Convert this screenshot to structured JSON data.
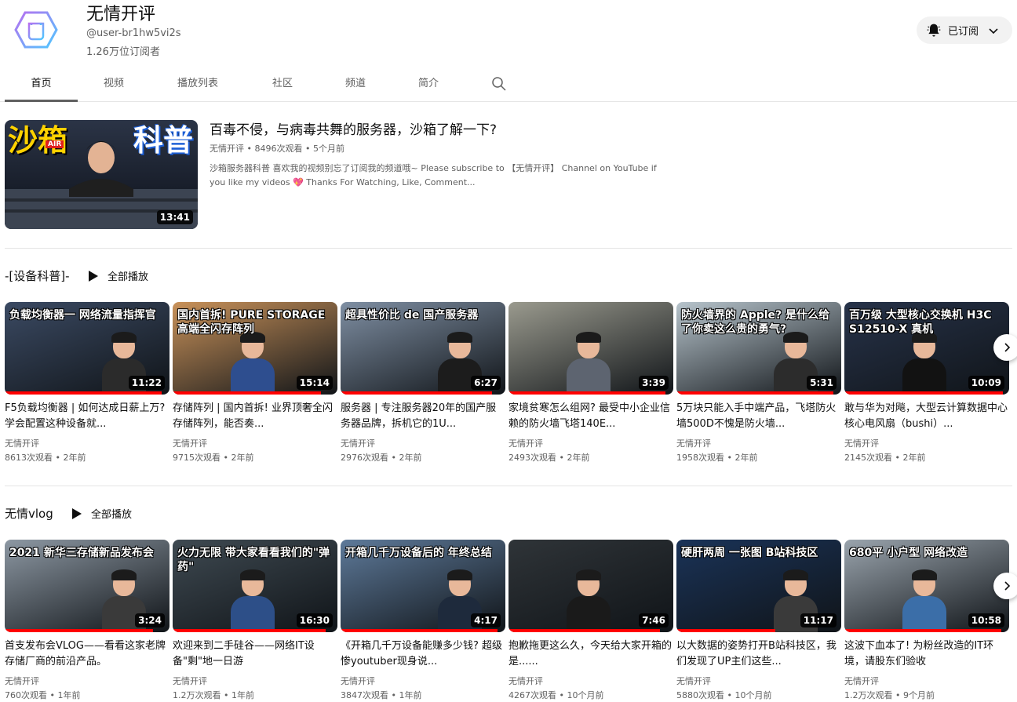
{
  "channel": {
    "name": "无情开评",
    "handle": "@user-br1hw5vi2s",
    "subscribers": "1.26万位订阅者",
    "subscribe_label": "已订阅"
  },
  "tabs": [
    {
      "label": "首页",
      "active": true
    },
    {
      "label": "视频"
    },
    {
      "label": "播放列表"
    },
    {
      "label": "社区"
    },
    {
      "label": "频道"
    },
    {
      "label": "简介"
    }
  ],
  "featured": {
    "thumb_text_left": "沙箱",
    "thumb_badge": "AIR",
    "thumb_text_right": "科普",
    "duration": "13:41",
    "title": "百毒不侵，与病毒共舞的服务器，沙箱了解一下?",
    "meta": "无情开评 • 8496次观看 • 5个月前",
    "desc_line1": "沙箱服务器科普 喜欢我的视频别忘了订阅我的频道哦~ Please subscribe to 【无情开评】 Channel on YouTube if",
    "desc_line2a": "you like my videos ",
    "desc_heart": "💖",
    "desc_line2b": " Thanks For Watching, Like, Comment..."
  },
  "shelf1": {
    "title": "-[设备科普]-",
    "play_all": "全部播放",
    "videos": [
      {
        "overlay": "负载均衡器一 网络流量指挥官",
        "duration": "11:22",
        "title": "F5负载均衡器 | 如何达成日薪上万? 学会配置这种设备就...",
        "channel": "无情开评",
        "meta": "8613次观看 • 2年前",
        "bg": "#3b4a63",
        "shirt": "#2b2b2b",
        "progress": 0.95
      },
      {
        "overlay": "国内首拆! PURE STORAGE 高端全闪存阵列",
        "duration": "15:14",
        "title": "存储阵列 | 国内首拆! 业界顶奢全闪存储阵列，能否奏...",
        "channel": "无情开评",
        "meta": "9715次观看 • 2年前",
        "bg": "#c9925a",
        "shirt": "#2e4e8f",
        "progress": 0.9
      },
      {
        "overlay": "超具性价比 de 国产服务器",
        "duration": "6:27",
        "title": "服务器 | 专注服务器20年的国产服务器品牌，拆机它的1U...",
        "channel": "无情开评",
        "meta": "2976次观看 • 2年前",
        "bg": "#7f8fa3",
        "shirt": "#1c1c1c",
        "progress": 0.92
      },
      {
        "overlay": "",
        "duration": "3:39",
        "title": "家境贫寒怎么组网? 最受中小企业信赖的防火墙飞塔140E...",
        "channel": "无情开评",
        "meta": "2493次观看 • 2年前",
        "bg": "#9a9a8e",
        "shirt": "#5d6470",
        "progress": 0.95
      },
      {
        "overlay": "防火墙界的 Apple? 是什么给了你卖这么贵的勇气?",
        "duration": "5:31",
        "title": "5万块只能入手中端产品，飞塔防火墙500D不愧是防火墙...",
        "channel": "无情开评",
        "meta": "1958次观看 • 2年前",
        "bg": "#b7c4cc",
        "shirt": "#2c2c2c",
        "progress": 0.95
      },
      {
        "overlay": "百万级 大型核心交换机 H3C S12510-X 真机",
        "duration": "10:09",
        "title": "敢与华为对飚，大型云计算数据中心核心电风扇（bushi）...",
        "channel": "无情开评",
        "meta": "2145次观看 • 2年前",
        "bg": "#27334a",
        "shirt": "#121212",
        "progress": 0.96
      }
    ]
  },
  "shelf2": {
    "title": "无情vlog",
    "play_all": "全部播放",
    "videos": [
      {
        "overlay": "2021 新华三存储新品发布会",
        "duration": "3:24",
        "title": "首支发布会VLOG——看看这家老牌存储厂商的前沿产品。",
        "channel": "无情开评",
        "meta": "760次观看 • 1年前",
        "bg": "#8d98a3",
        "shirt": "#3a3a3a",
        "progress": 0.9
      },
      {
        "overlay": "火力无限 带大家看看我们的\"弹药\"",
        "duration": "16:30",
        "title": "欢迎来到二手硅谷——网络IT设备\"剩\"地一日游",
        "channel": "无情开评",
        "meta": "1.2万次观看 • 1年前",
        "bg": "#3f4a52",
        "shirt": "#2d4f88",
        "progress": 0.93
      },
      {
        "overlay": "开箱几千万设备后的 年终总结",
        "duration": "4:17",
        "title": "《开箱几千万设备能赚多少钱? 超级惨youtuber现身说...",
        "channel": "无情开评",
        "meta": "3847次观看 • 1年前",
        "bg": "#5e7a9a",
        "shirt": "#1e2a3c",
        "progress": 0.95
      },
      {
        "overlay": "",
        "duration": "7:46",
        "title": "抱歉拖更这么久，今天给大家开箱的是......",
        "channel": "无情开评",
        "meta": "4267次观看 • 10个月前",
        "bg": "#2f3438",
        "shirt": "#1a1a1a",
        "progress": 0.92
      },
      {
        "overlay": "硬肝两周 一张图 B站科技区",
        "duration": "11:17",
        "title": "以大数据的姿势打开B站科技区，我们发现了UP主们这些...",
        "channel": "无情开评",
        "meta": "5880次观看 • 10个月前",
        "bg": "#1a3358",
        "shirt": "#3a3a3a",
        "progress": 0.6
      },
      {
        "overlay": "680平 小户型 网络改造",
        "duration": "10:58",
        "title": "这波下血本了! 为粉丝改造的IT环境，请股东们验收",
        "channel": "无情开评",
        "meta": "1.2万次观看 • 9个月前",
        "bg": "#9aa4ad",
        "shirt": "#3b6ea8",
        "progress": 0.95
      }
    ]
  },
  "colors": {
    "accent_red": "#ff0000",
    "text_secondary": "#606060",
    "subscribe_bg": "#f2f2f2"
  }
}
